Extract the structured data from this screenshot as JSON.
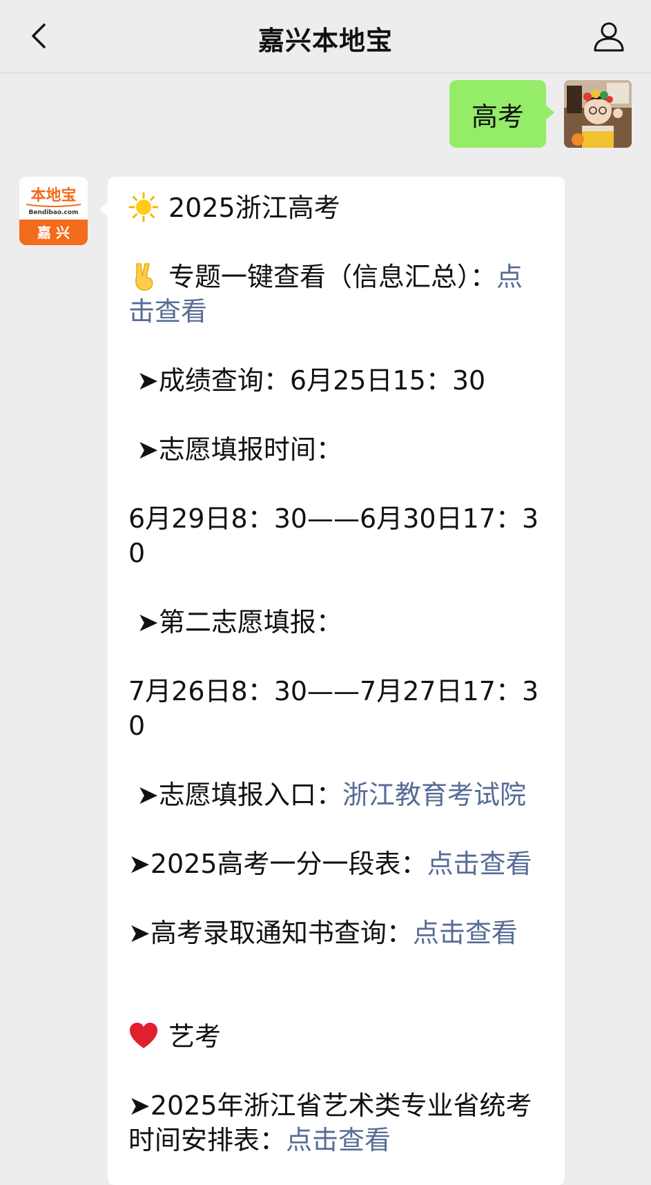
{
  "header": {
    "title": "嘉兴本地宝"
  },
  "outgoing": {
    "text": "高考"
  },
  "bot_avatar": {
    "logo_text": "本地宝",
    "site_text": "Bendibao.com",
    "city_text": "嘉 兴"
  },
  "message": {
    "l1": "2025浙江高考",
    "l2_text": "专题一键查看（信息汇总）：",
    "l2_link": "点击查看",
    "l3": " ➤成绩查询：6月25日15：30",
    "l4": " ➤志愿填报时间：",
    "l5": "6月29日8：30——6月30日17：30",
    "l6": " ➤第二志愿填报：",
    "l7": "7月26日8：30——7月27日17：30",
    "l8_text": " ➤志愿填报入口：",
    "l8_link": "浙江教育考试院",
    "l9_text": "➤2025高考一分一段表：",
    "l9_link": "点击查看",
    "l10_text": "➤高考录取通知书查询：",
    "l10_link": "点击查看",
    "l11": "艺考",
    "l12_text": "➤2025年浙江省艺术类专业省统考时间安排表：",
    "l12_link": "点击查看"
  },
  "icons": {
    "back": "chevron-left-icon",
    "profile": "person-icon",
    "sun": "sun-emoji-icon",
    "victory": "victory-hand-emoji-icon",
    "heart": "red-heart-emoji-icon"
  },
  "colors": {
    "background": "#ededed",
    "outgoing_bubble": "#95ec69",
    "incoming_bubble": "#ffffff",
    "link": "#576b95",
    "logo_orange": "#f36b1c"
  }
}
